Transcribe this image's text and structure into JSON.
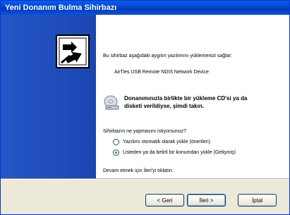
{
  "window": {
    "title": "Yeni Donanım Bulma Sihirbazı"
  },
  "content": {
    "intro": "Bu sihirbaz aşağıdaki aygıtın yazılımını yüklemenizi sağlar:",
    "device": "AirTies USB Remote NDIS Network Device",
    "cd_prompt_line1": "Donanımınızla birlikte bir yükleme CD'si ya da",
    "cd_prompt_line2": "disketi verildiyse, şimdi takın.",
    "question": "Sihirbazın ne yapmasını istiyorsunuz?",
    "options": [
      {
        "label": "Yazılımı otomatik olarak yükle (önerilen)",
        "selected": false
      },
      {
        "label": "Listeden ya da belirli bir konumdan yükle (Gelişmiş)",
        "selected": true
      }
    ],
    "continue_hint": "Devam etmek için İleri'yi tıklatın."
  },
  "buttons": {
    "back": "< Geri",
    "next": "İleri >",
    "cancel": "İptal"
  },
  "colors": {
    "banner": "#1d4fbf",
    "titlebar": "#0a5fe8",
    "radio_dot": "#21a121"
  }
}
